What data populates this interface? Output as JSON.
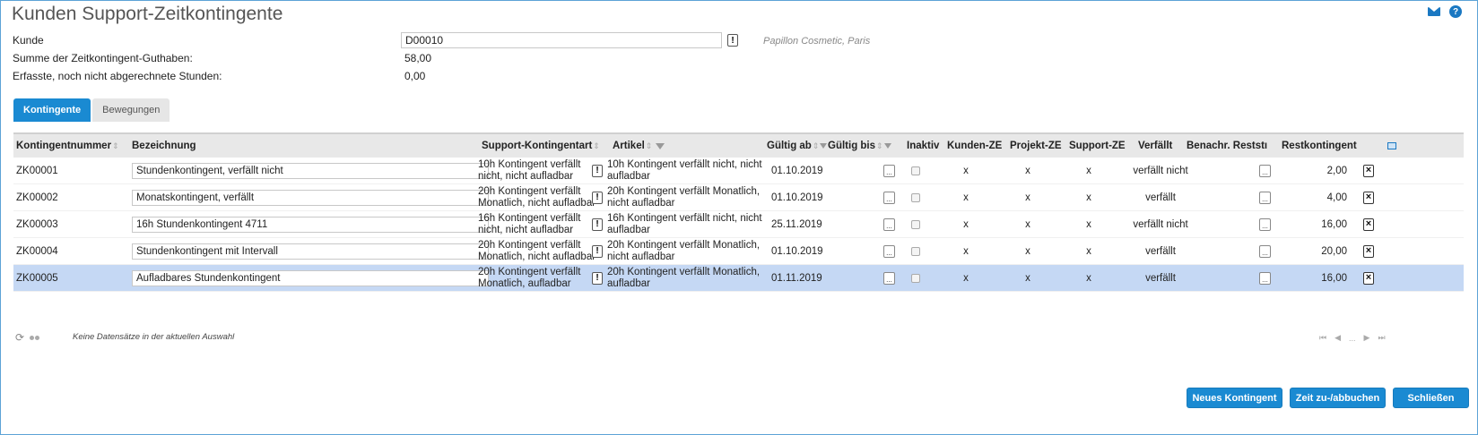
{
  "title": "Kunden Support-Zeitkontingente",
  "fields": {
    "kunde_label": "Kunde",
    "kunde_value": "D00010",
    "kunde_name": "Papillon Cosmetic, Paris",
    "summe_label": "Summe der Zeitkontingent-Guthaben:",
    "summe_value": "58,00",
    "erfasst_label": "Erfasste, noch nicht abgerechnete Stunden:",
    "erfasst_value": "0,00"
  },
  "tabs": [
    {
      "label": "Kontingente",
      "active": true
    },
    {
      "label": "Bewegungen",
      "active": false
    }
  ],
  "columns": {
    "nummer": "Kontingentnummer",
    "bezeichnung": "Bezeichnung",
    "art": "Support-Kontingentart",
    "artikel": "Artikel",
    "gueltig_ab": "Gültig ab",
    "gueltig_bis": "Gültig bis",
    "inaktiv": "Inaktiv",
    "kunden_ze": "Kunden-ZE",
    "projekt_ze": "Projekt-ZE",
    "support_ze": "Support-ZE",
    "verfaellt": "Verfällt",
    "benachr": "Benachr. Reststı",
    "rest": "Restkontingent"
  },
  "rows": [
    {
      "nummer": "ZK00001",
      "bezeichnung": "Stundenkontingent, verfällt nicht",
      "art1": "10h Kontingent verfällt",
      "art2": "nicht, nicht aufladbar",
      "artikel1": "10h Kontingent verfällt nicht, nicht",
      "artikel2": "aufladbar",
      "gueltig_ab": "01.10.2019",
      "kunden_ze": "x",
      "projekt_ze": "x",
      "support_ze": "x",
      "verfaellt": "verfällt nicht",
      "rest": "2,00",
      "selected": false
    },
    {
      "nummer": "ZK00002",
      "bezeichnung": "Monatskontingent, verfällt",
      "art1": "20h Kontingent verfällt",
      "art2": "Monatlich, nicht aufladbar",
      "artikel1": "20h Kontingent verfällt Monatlich,",
      "artikel2": "nicht aufladbar",
      "gueltig_ab": "01.10.2019",
      "kunden_ze": "x",
      "projekt_ze": "x",
      "support_ze": "x",
      "verfaellt": "verfällt",
      "rest": "4,00",
      "selected": false
    },
    {
      "nummer": "ZK00003",
      "bezeichnung": "16h Stundenkontingent 4711",
      "art1": "16h Kontingent verfällt",
      "art2": "nicht, nicht aufladbar",
      "artikel1": "16h Kontingent verfällt nicht, nicht",
      "artikel2": "aufladbar",
      "gueltig_ab": "25.11.2019",
      "kunden_ze": "x",
      "projekt_ze": "x",
      "support_ze": "x",
      "verfaellt": "verfällt nicht",
      "rest": "16,00",
      "selected": false
    },
    {
      "nummer": "ZK00004",
      "bezeichnung": "Stundenkontingent mit Intervall",
      "art1": "20h Kontingent verfällt",
      "art2": "Monatlich, nicht aufladbar",
      "artikel1": "20h Kontingent verfällt Monatlich,",
      "artikel2": "nicht aufladbar",
      "gueltig_ab": "01.10.2019",
      "kunden_ze": "x",
      "projekt_ze": "x",
      "support_ze": "x",
      "verfaellt": "verfällt",
      "rest": "20,00",
      "selected": false
    },
    {
      "nummer": "ZK00005",
      "bezeichnung": "Aufladbares Stundenkontingent",
      "art1": "20h Kontingent verfällt",
      "art2": "Monatlich, aufladbar",
      "artikel1": "20h Kontingent verfällt Monatlich,",
      "artikel2": "aufladbar",
      "gueltig_ab": "01.11.2019",
      "kunden_ze": "x",
      "projekt_ze": "x",
      "support_ze": "x",
      "verfaellt": "verfällt",
      "rest": "16,00",
      "selected": true
    }
  ],
  "footer": {
    "status": "Keine Datensätze in der aktuellen Auswahl",
    "pager_ellipsis": "..."
  },
  "buttons": {
    "neues_kontingent": "Neues Kontingent",
    "zeit_buchen": "Zeit zu-/abbuchen",
    "schliessen": "Schließen"
  },
  "icons": {
    "mail": "mail-icon",
    "help": "help-icon",
    "excl": "!",
    "dots": "...",
    "delete": "×"
  },
  "colors": {
    "accent": "#1a8ad2",
    "selected_row": "#c5d8f4",
    "header_bg": "#e8e8e8"
  }
}
